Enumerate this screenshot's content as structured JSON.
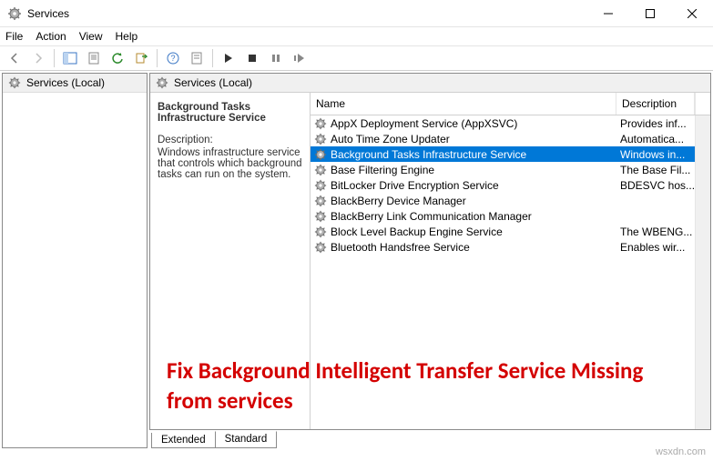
{
  "window": {
    "title": "Services"
  },
  "menubar": [
    "File",
    "Action",
    "View",
    "Help"
  ],
  "nav": {
    "label": "Services (Local)"
  },
  "panel": {
    "header": "Services (Local)",
    "selected_name": "Background Tasks Infrastructure Service",
    "desc_label": "Description:",
    "desc_text": "Windows infrastructure service that controls which background tasks can run on the system."
  },
  "columns": {
    "name": "Name",
    "desc": "Description"
  },
  "rows": [
    {
      "name": "AppX Deployment Service (AppXSVC)",
      "desc": "Provides inf...",
      "selected": false
    },
    {
      "name": "Auto Time Zone Updater",
      "desc": "Automatica...",
      "selected": false
    },
    {
      "name": "Background Tasks Infrastructure Service",
      "desc": "Windows in...",
      "selected": true
    },
    {
      "name": "Base Filtering Engine",
      "desc": "The Base Fil...",
      "selected": false
    },
    {
      "name": "BitLocker Drive Encryption Service",
      "desc": "BDESVC hos...",
      "selected": false
    },
    {
      "name": "BlackBerry Device Manager",
      "desc": "",
      "selected": false
    },
    {
      "name": "BlackBerry Link Communication Manager",
      "desc": "",
      "selected": false
    },
    {
      "name": "Block Level Backup Engine Service",
      "desc": "The WBENG...",
      "selected": false
    },
    {
      "name": "Bluetooth Handsfree Service",
      "desc": "Enables wir...",
      "selected": false
    }
  ],
  "tabs": {
    "extended": "Extended",
    "standard": "Standard"
  },
  "overlay": "Fix Background Intelligent Transfer Service Missing from services",
  "watermark": "wsxdn.com"
}
